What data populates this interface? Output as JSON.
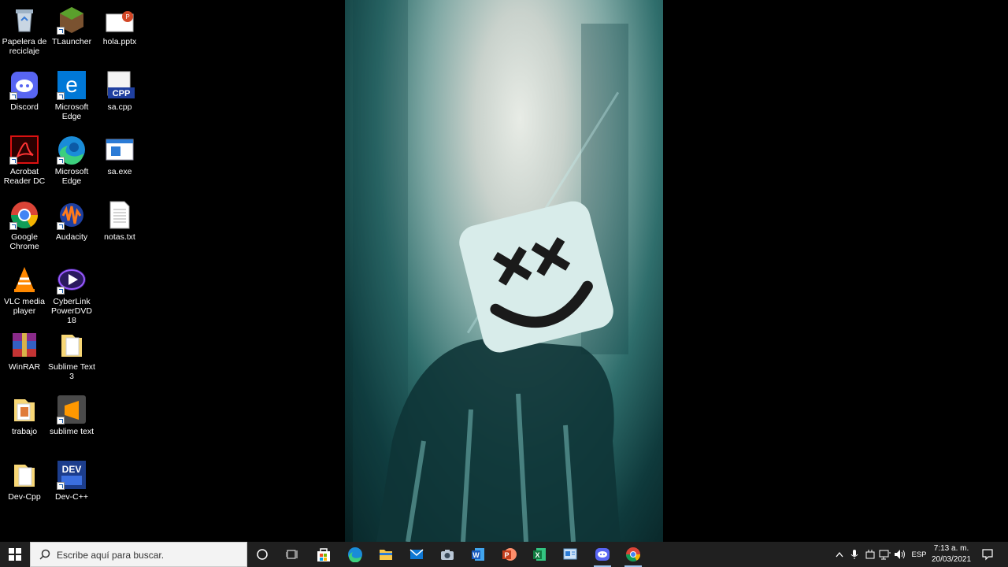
{
  "desktop": {
    "icons": [
      {
        "label": "Papelera de reciclaje",
        "icon": "recycle-bin-icon"
      },
      {
        "label": "TLauncher",
        "icon": "grass-block-icon"
      },
      {
        "label": "hola.pptx",
        "icon": "pptx-file-icon"
      },
      {
        "label": "Discord",
        "icon": "discord-icon"
      },
      {
        "label": "Microsoft Edge",
        "icon": "edge-legacy-icon"
      },
      {
        "label": "sa.cpp",
        "icon": "cpp-file-icon",
        "badge": "CPP"
      },
      {
        "label": "Acrobat Reader DC",
        "icon": "acrobat-icon"
      },
      {
        "label": "Microsoft Edge",
        "icon": "edge-icon"
      },
      {
        "label": "sa.exe",
        "icon": "exe-file-icon"
      },
      {
        "label": "Google Chrome",
        "icon": "chrome-icon"
      },
      {
        "label": "Audacity",
        "icon": "audacity-icon"
      },
      {
        "label": "notas.txt",
        "icon": "text-file-icon"
      },
      {
        "label": "VLC media player",
        "icon": "vlc-icon"
      },
      {
        "label": "CyberLink PowerDVD 18",
        "icon": "powerdvd-icon"
      },
      {
        "label": "WinRAR",
        "icon": "winrar-icon"
      },
      {
        "label": "Sublime Text 3",
        "icon": "folder-icon"
      },
      {
        "label": "trabajo",
        "icon": "folder-icon"
      },
      {
        "label": "sublime text",
        "icon": "sublime-icon"
      },
      {
        "label": "Dev-Cpp",
        "icon": "folder-icon"
      },
      {
        "label": "Dev-C++",
        "icon": "devcpp-icon",
        "badge": "DEV"
      }
    ]
  },
  "taskbar": {
    "search_placeholder": "Escribe aquí para buscar.",
    "apps": [
      "cortana-icon",
      "task-view-icon",
      "store-icon",
      "edge-icon",
      "file-explorer-icon",
      "mail-icon",
      "camera-icon",
      "word-icon",
      "powerpoint-icon",
      "excel-icon",
      "control-panel-icon",
      "discord-icon",
      "chrome-icon"
    ],
    "tray": {
      "language": "ESP",
      "time": "7:13 a. m.",
      "date": "20/03/2021"
    }
  },
  "colors": {
    "taskbar_bg": "#202020",
    "desktop_bg": "#000000",
    "wallpaper_accent": "#2f6e6c"
  }
}
